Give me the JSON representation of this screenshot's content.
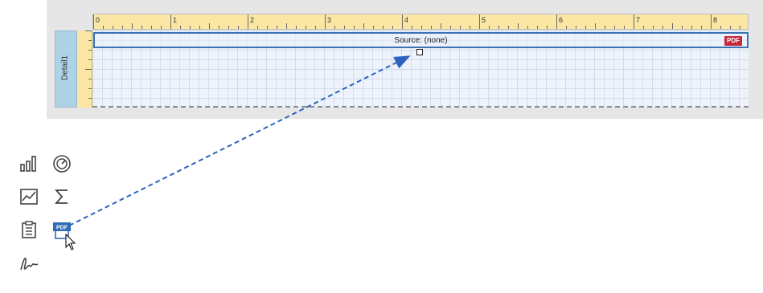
{
  "ruler": {
    "numbers": [
      "0",
      "1",
      "2",
      "3",
      "4",
      "5",
      "6",
      "7",
      "8"
    ]
  },
  "band": {
    "name": "Detail1"
  },
  "control": {
    "caption": "Source: (none)",
    "badge": "PDF"
  },
  "toolbox": {
    "items": [
      {
        "name": "bar-chart-tool",
        "icon": "bar-chart-icon"
      },
      {
        "name": "gauge-tool",
        "icon": "gauge-icon"
      },
      {
        "name": "sparkline-tool",
        "icon": "line-chart-icon"
      },
      {
        "name": "summary-tool",
        "icon": "sigma-icon"
      },
      {
        "name": "page-info-tool",
        "icon": "clipboard-icon"
      },
      {
        "name": "pdf-content-tool",
        "icon": "pdf-icon",
        "label": "PDF"
      },
      {
        "name": "signature-tool",
        "icon": "signature-icon"
      }
    ]
  },
  "colors": {
    "accent": "#3c72b4",
    "pdf_red": "#c4283a",
    "ruler": "#fbe7a3",
    "band": "#aed3e6"
  }
}
